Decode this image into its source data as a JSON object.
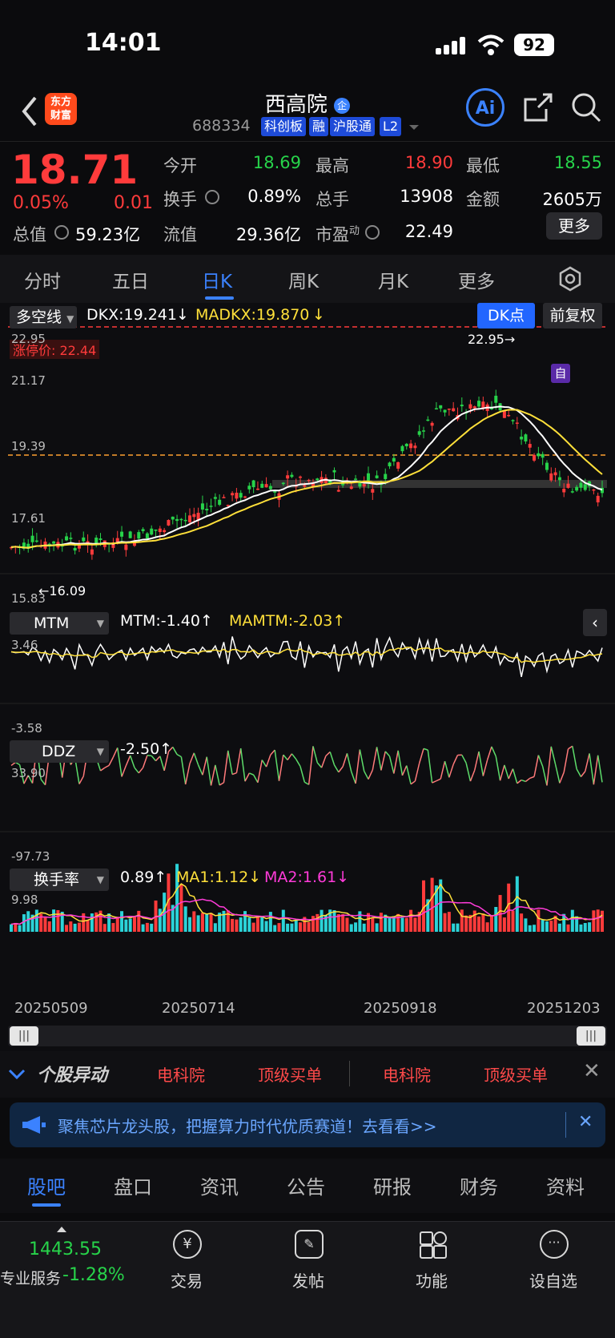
{
  "status_bar": {
    "time": "14:01",
    "battery": "92"
  },
  "header": {
    "stock_name": "西高院",
    "name_badge": "企",
    "stock_code": "688334",
    "tags": [
      "科创板",
      "融",
      "沪股通",
      "L2"
    ],
    "logo_text": [
      "东方",
      "财富"
    ],
    "ai_label": "Ai"
  },
  "quote": {
    "price": "18.71",
    "change_pct": "0.05%",
    "change": "0.01",
    "total_value_label": "总值",
    "total_value": "59.23亿",
    "fields": [
      {
        "label": "今开",
        "value": "18.69",
        "color": "#27d34a"
      },
      {
        "label": "最高",
        "value": "18.90",
        "color": "#ff3b3b"
      },
      {
        "label": "最低",
        "value": "18.55",
        "color": "#27d34a"
      },
      {
        "label": "换手",
        "value": "0.89%",
        "color": "#ffffff"
      },
      {
        "label": "总手",
        "value": "13908",
        "color": "#ffffff"
      },
      {
        "label": "金额",
        "value": "2605万",
        "color": "#ffffff"
      },
      {
        "label": "流值",
        "value": "29.36亿",
        "color": "#ffffff"
      },
      {
        "label": "市盈",
        "value": "22.49",
        "color": "#ffffff"
      }
    ],
    "pe_superscript": "动",
    "more_label": "更多"
  },
  "period_tabs": [
    "分时",
    "五日",
    "日K",
    "周K",
    "月K",
    "更多"
  ],
  "active_period_tab": "日K",
  "kline": {
    "indicator_name": "多空线",
    "dkx_label": "DKX:19.241",
    "madkx_label": "MADKX:19.870",
    "dk_button": "DK点",
    "adjust_button": "前复权",
    "limit_price_label": "涨停价: 22.44",
    "y_labels": [
      "22.95",
      "21.17",
      "19.39",
      "17.61",
      "15.83"
    ],
    "high_marker": "22.95",
    "low_marker": "16.09",
    "self_marker": "自"
  },
  "mtm": {
    "name": "MTM",
    "value_label": "MTM:-1.40",
    "ma_label": "MAMTM:-2.03",
    "y_max": "3.46",
    "y_min": "-3.58"
  },
  "ddz": {
    "name": "DDZ",
    "value_label": "-2.50",
    "y_max": "33.90",
    "y_min": "-97.73"
  },
  "turnover": {
    "name": "换手率",
    "value_label": "0.89",
    "ma1_label": "MA1:1.12",
    "ma2_label": "MA2:1.61",
    "y_max": "9.98"
  },
  "dates": [
    "20250509",
    "20250714",
    "20250918",
    "20251203"
  ],
  "ticker": {
    "title": "个股异动",
    "items": [
      "电科院",
      "顶级买单",
      "电科院",
      "顶级买单"
    ]
  },
  "banner": {
    "text": "聚焦芯片龙头股，把握算力时代优质赛道！去看看>>"
  },
  "bottom_tabs": [
    "股吧",
    "盘口",
    "资讯",
    "公告",
    "研报",
    "财务",
    "资料"
  ],
  "active_bottom_tab": "股吧",
  "nav": {
    "index_value": "1443.55",
    "index_change": "-1.28%",
    "index_label": "专业服务",
    "items": [
      "交易",
      "发帖",
      "功能",
      "设自选"
    ]
  },
  "colors": {
    "up": "#ff3b3b",
    "down": "#27d34a",
    "accent": "#3b82ff",
    "dkx": "#ffffff",
    "madkx": "#ffe03a"
  }
}
